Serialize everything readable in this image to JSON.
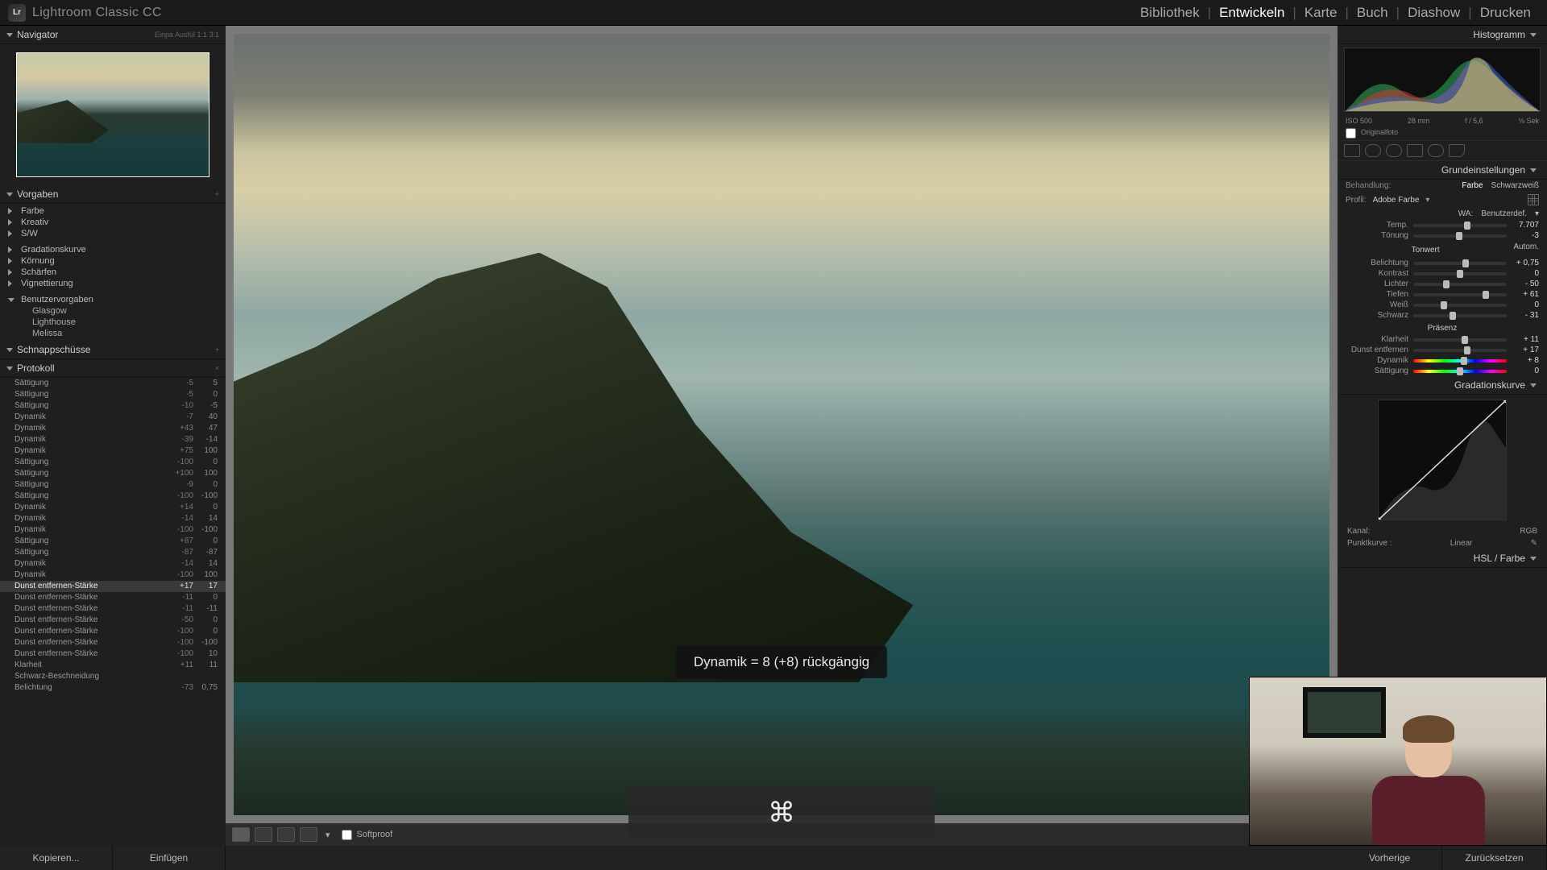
{
  "app": {
    "title": "Lightroom Classic CC",
    "logo": "Lr"
  },
  "modules": [
    "Bibliothek",
    "Entwickeln",
    "Karte",
    "Buch",
    "Diashow",
    "Drucken"
  ],
  "active_module": "Entwickeln",
  "navigator": {
    "title": "Navigator",
    "zoom_labels": "Einpa   Ausfül   1:1   3:1"
  },
  "presets": {
    "title": "Vorgaben",
    "groups": [
      "Farbe",
      "Kreativ",
      "S/W"
    ],
    "more_groups": [
      "Gradationskurve",
      "Körnung",
      "Schärfen",
      "Vignettierung"
    ],
    "user_group": "Benutzervorgaben",
    "user_items": [
      "Glasgow",
      "Lighthouse",
      "Melissa"
    ]
  },
  "snapshots": {
    "title": "Schnappschüsse"
  },
  "history": {
    "title": "Protokoll",
    "rows": [
      {
        "label": "Sättigung",
        "v1": "-5",
        "v2": "5"
      },
      {
        "label": "Sättigung",
        "v1": "-5",
        "v2": "0"
      },
      {
        "label": "Sättigung",
        "v1": "-10",
        "v2": "-5"
      },
      {
        "label": "Dynamik",
        "v1": "-7",
        "v2": "40"
      },
      {
        "label": "Dynamik",
        "v1": "+43",
        "v2": "47"
      },
      {
        "label": "Dynamik",
        "v1": "-39",
        "v2": "-14"
      },
      {
        "label": "Dynamik",
        "v1": "+75",
        "v2": "100"
      },
      {
        "label": "Sättigung",
        "v1": "-100",
        "v2": "0"
      },
      {
        "label": "Sättigung",
        "v1": "+100",
        "v2": "100"
      },
      {
        "label": "Sättigung",
        "v1": "-9",
        "v2": "0"
      },
      {
        "label": "Sättigung",
        "v1": "-100",
        "v2": "-100"
      },
      {
        "label": "Dynamik",
        "v1": "+14",
        "v2": "0"
      },
      {
        "label": "Dynamik",
        "v1": "-14",
        "v2": "14"
      },
      {
        "label": "Dynamik",
        "v1": "-100",
        "v2": "-100"
      },
      {
        "label": "Sättigung",
        "v1": "+87",
        "v2": "0"
      },
      {
        "label": "Sättigung",
        "v1": "-87",
        "v2": "-87"
      },
      {
        "label": "Dynamik",
        "v1": "-14",
        "v2": "14"
      },
      {
        "label": "Dynamik",
        "v1": "-100",
        "v2": "100"
      },
      {
        "label": "Dunst entfernen-Stärke",
        "v1": "+17",
        "v2": "17",
        "active": true
      },
      {
        "label": "Dunst entfernen-Stärke",
        "v1": "-11",
        "v2": "0"
      },
      {
        "label": "Dunst entfernen-Stärke",
        "v1": "-11",
        "v2": "-11"
      },
      {
        "label": "Dunst entfernen-Stärke",
        "v1": "-50",
        "v2": "0"
      },
      {
        "label": "Dunst entfernen-Stärke",
        "v1": "-100",
        "v2": "0"
      },
      {
        "label": "Dunst entfernen-Stärke",
        "v1": "-100",
        "v2": "-100"
      },
      {
        "label": "Dunst entfernen-Stärke",
        "v1": "-100",
        "v2": "10"
      },
      {
        "label": "Klarheit",
        "v1": "+11",
        "v2": "11"
      },
      {
        "label": "Schwarz-Beschneidung",
        "v1": "",
        "v2": ""
      },
      {
        "label": "Belichtung",
        "v1": "-73",
        "v2": "0,75"
      }
    ]
  },
  "left_buttons": {
    "copy": "Kopieren...",
    "paste": "Einfügen"
  },
  "toolbar": {
    "softproof": "Softproof"
  },
  "toast": "Dynamik = 8 (+8) rückgängig",
  "key_overlay": "⌘",
  "histogram": {
    "title": "Histogramm",
    "meta": {
      "iso": "ISO 500",
      "focal": "28 mm",
      "aperture": "f / 5,6",
      "shutter": "⅛ Sek"
    },
    "original": "Originalfoto"
  },
  "basic": {
    "title": "Grundeinstellungen",
    "treatment": {
      "label": "Behandlung:",
      "color": "Farbe",
      "bw": "Schwarzweiß"
    },
    "profile": {
      "label": "Profil:",
      "name": "Adobe Farbe"
    },
    "wb": {
      "label": "WA:",
      "preset": "Benutzerdef."
    },
    "sliders_wb": [
      {
        "label": "Temp.",
        "value": "7.707",
        "pos": 58
      },
      {
        "label": "Tönung",
        "value": "-3",
        "pos": 49
      }
    ],
    "tone_hdr": "Tonwert",
    "auto": "Autom.",
    "sliders_tone": [
      {
        "label": "Belichtung",
        "value": "+ 0,75",
        "pos": 56
      },
      {
        "label": "Kontrast",
        "value": "0",
        "pos": 50
      },
      {
        "label": "Lichter",
        "value": "- 50",
        "pos": 35
      },
      {
        "label": "Tiefen",
        "value": "+ 61",
        "pos": 78
      },
      {
        "label": "Weiß",
        "value": "0",
        "pos": 33
      },
      {
        "label": "Schwarz",
        "value": "- 31",
        "pos": 42
      }
    ],
    "presence_hdr": "Präsenz",
    "sliders_presence": [
      {
        "label": "Klarheit",
        "value": "+ 11",
        "pos": 55
      },
      {
        "label": "Dunst entfernen",
        "value": "+ 17",
        "pos": 58
      },
      {
        "label": "Dynamik",
        "value": "+ 8",
        "pos": 54,
        "rainbow": true
      },
      {
        "label": "Sättigung",
        "value": "0",
        "pos": 50,
        "rainbow": true
      }
    ]
  },
  "tone_curve": {
    "title": "Gradationskurve",
    "channel_lbl": "Kanal:",
    "channel": "RGB",
    "point_lbl": "Punktkurve :",
    "point": "Linear"
  },
  "hsl": {
    "title": "HSL / Farbe"
  },
  "right_buttons": {
    "prev": "Vorherige",
    "reset": "Zurücksetzen"
  }
}
